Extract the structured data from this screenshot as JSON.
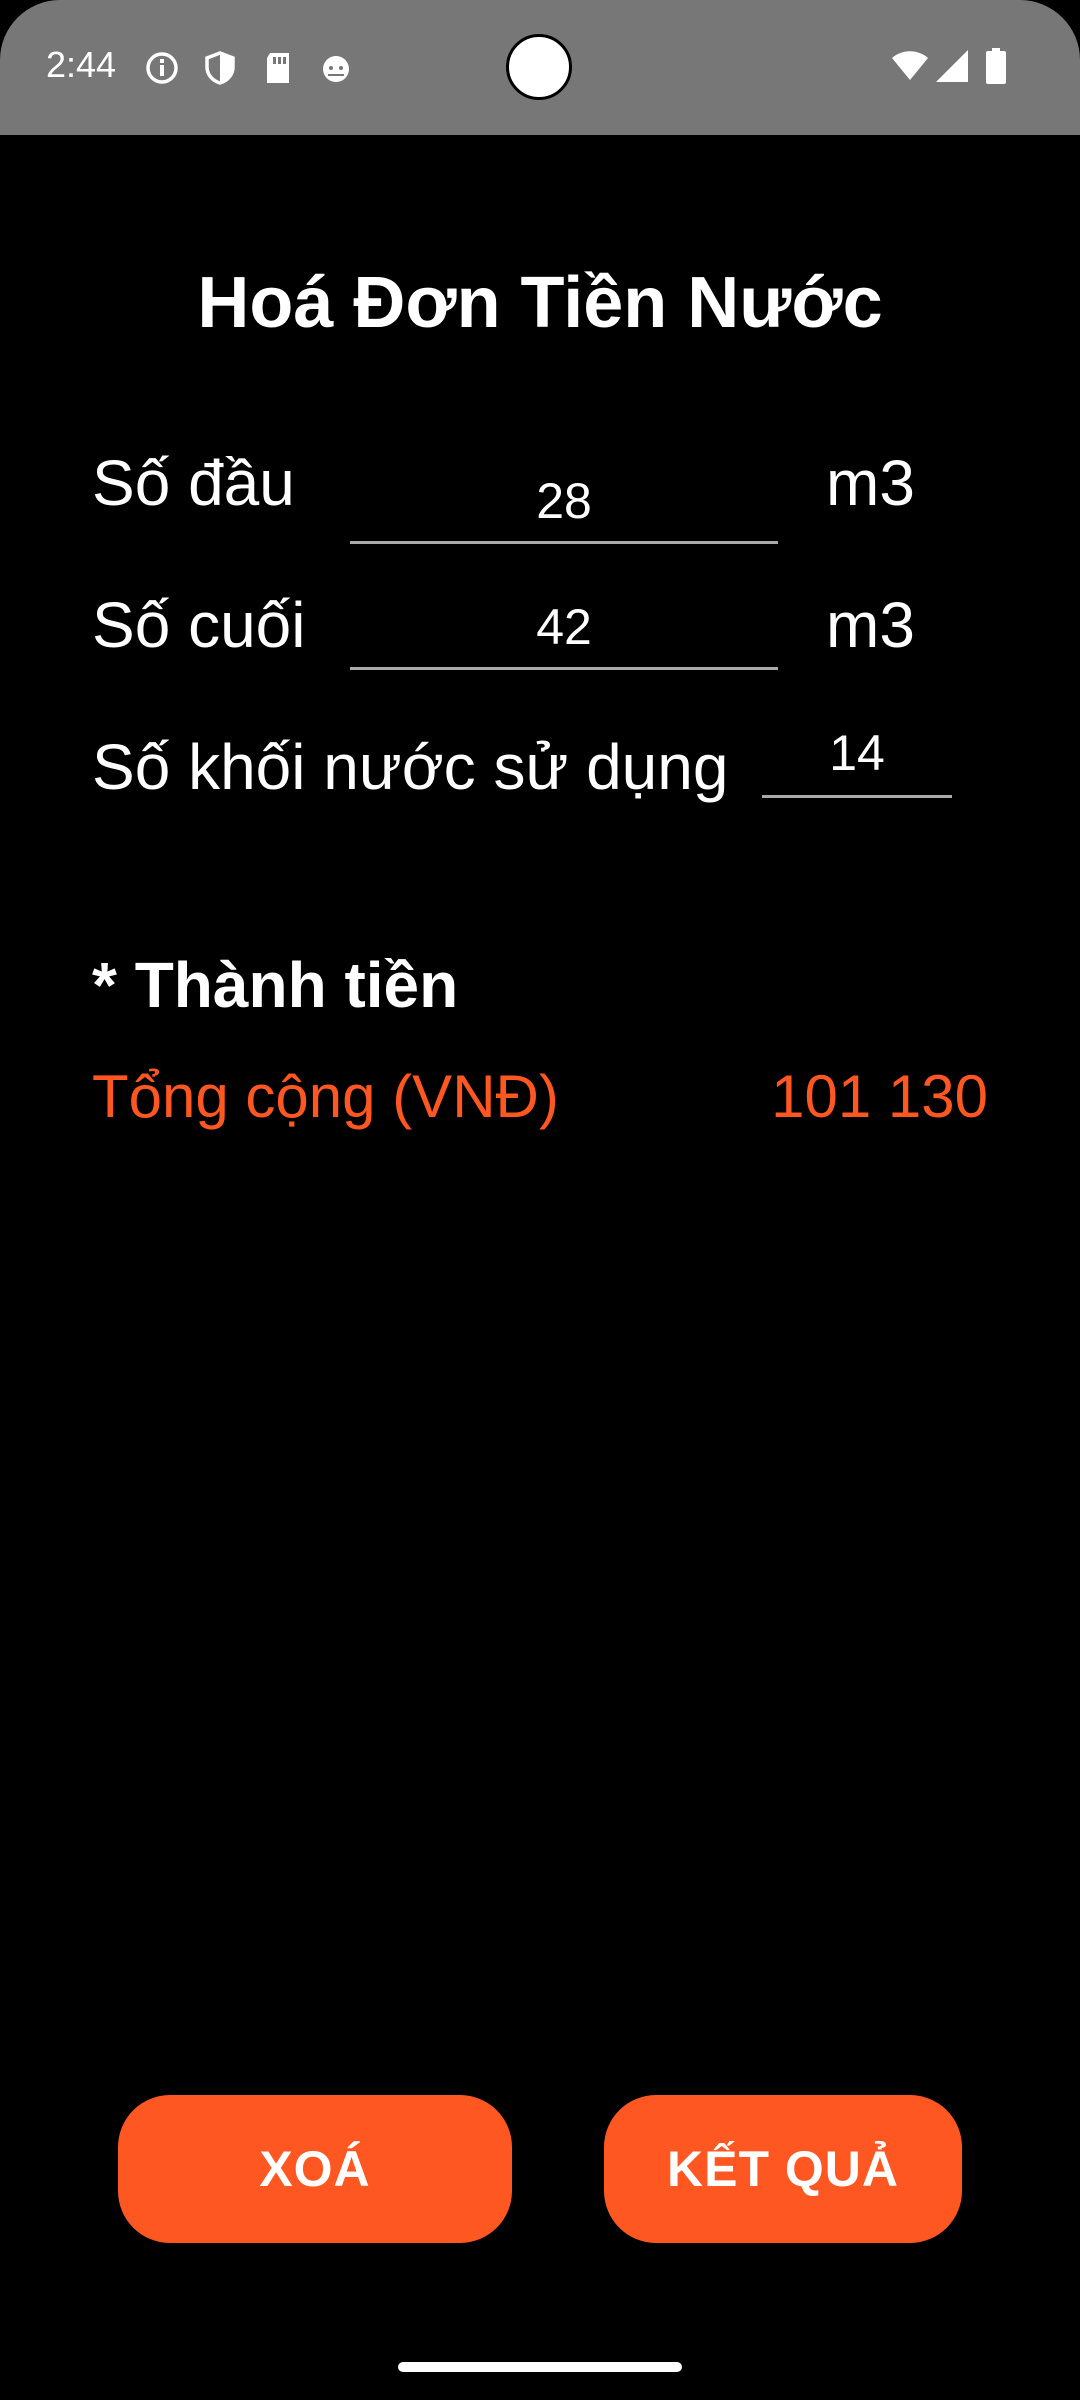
{
  "status_bar": {
    "time": "2:44",
    "left_icons": [
      "info-icon",
      "shield-icon",
      "sd-card-icon",
      "android-icon"
    ],
    "right_icons": [
      "wifi-icon",
      "signal-icon",
      "battery-icon"
    ]
  },
  "app": {
    "title": "Hoá Đơn Tiền Nước"
  },
  "form": {
    "start_label": "Số đầu",
    "start_value": "28",
    "start_unit": "m3",
    "end_label": "Số cuối",
    "end_value": "42",
    "end_unit": "m3",
    "usage_label": "Số khối nước sử dụng",
    "usage_value": "14"
  },
  "result": {
    "section_title": "* Thành tiền",
    "total_label": "Tổng cộng (VNĐ)",
    "total_value": "101 130"
  },
  "buttons": {
    "clear_label": "XOÁ",
    "result_label": "KẾT QUẢ"
  },
  "colors": {
    "accent": "#ff5722",
    "background": "#000000",
    "status_bar": "#777777"
  }
}
